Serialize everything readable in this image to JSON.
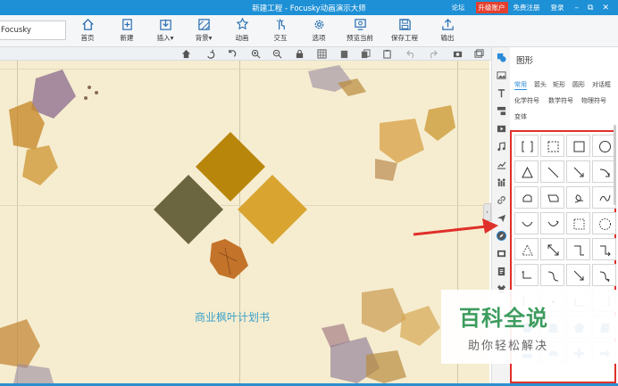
{
  "titlebar": {
    "title": "新建工程 - Focusky动画演示大师",
    "forum": "论坛",
    "upgrade": "升级账户",
    "register": "免费注册",
    "login": "登录",
    "min": "–",
    "max": "⧉",
    "close": "✕"
  },
  "toolbar": {
    "project_name": "Focusky",
    "buttons": [
      {
        "label": "首页",
        "icon": "home-icon"
      },
      {
        "label": "新建",
        "icon": "new-file-icon"
      },
      {
        "label": "插入",
        "icon": "insert-icon"
      },
      {
        "label": "背景",
        "icon": "background-icon"
      },
      {
        "label": "动画",
        "icon": "animation-icon"
      },
      {
        "label": "交互",
        "icon": "interaction-icon"
      },
      {
        "label": "选项",
        "icon": "gear-icon"
      },
      {
        "label": "预览当前",
        "icon": "preview-icon"
      },
      {
        "label": "保存工程",
        "icon": "save-icon"
      },
      {
        "label": "输出",
        "icon": "export-icon"
      }
    ],
    "dropdown_arrow": "▾"
  },
  "canvas": {
    "title_text": "商业枫叶计划书"
  },
  "collapse_glyph": "›",
  "panel": {
    "title": "图形",
    "tabs_row1": [
      "常用",
      "箭头",
      "矩形",
      "圆形",
      "对话框"
    ],
    "tabs_row2": [
      "化学符号",
      "数学符号",
      "物理符号"
    ],
    "tabs_row3": [
      "变体"
    ],
    "active_tab": "常用"
  },
  "watermark": {
    "line1": "百科全说",
    "line2": "助你轻松解决"
  },
  "colors": {
    "titlebar": "#1e90d6",
    "accent": "#2a8ad8",
    "diamond_dark": "#6b6540",
    "diamond_mid": "#b8860b",
    "diamond_light": "#d9a530",
    "highlight_box": "#e0302a"
  }
}
